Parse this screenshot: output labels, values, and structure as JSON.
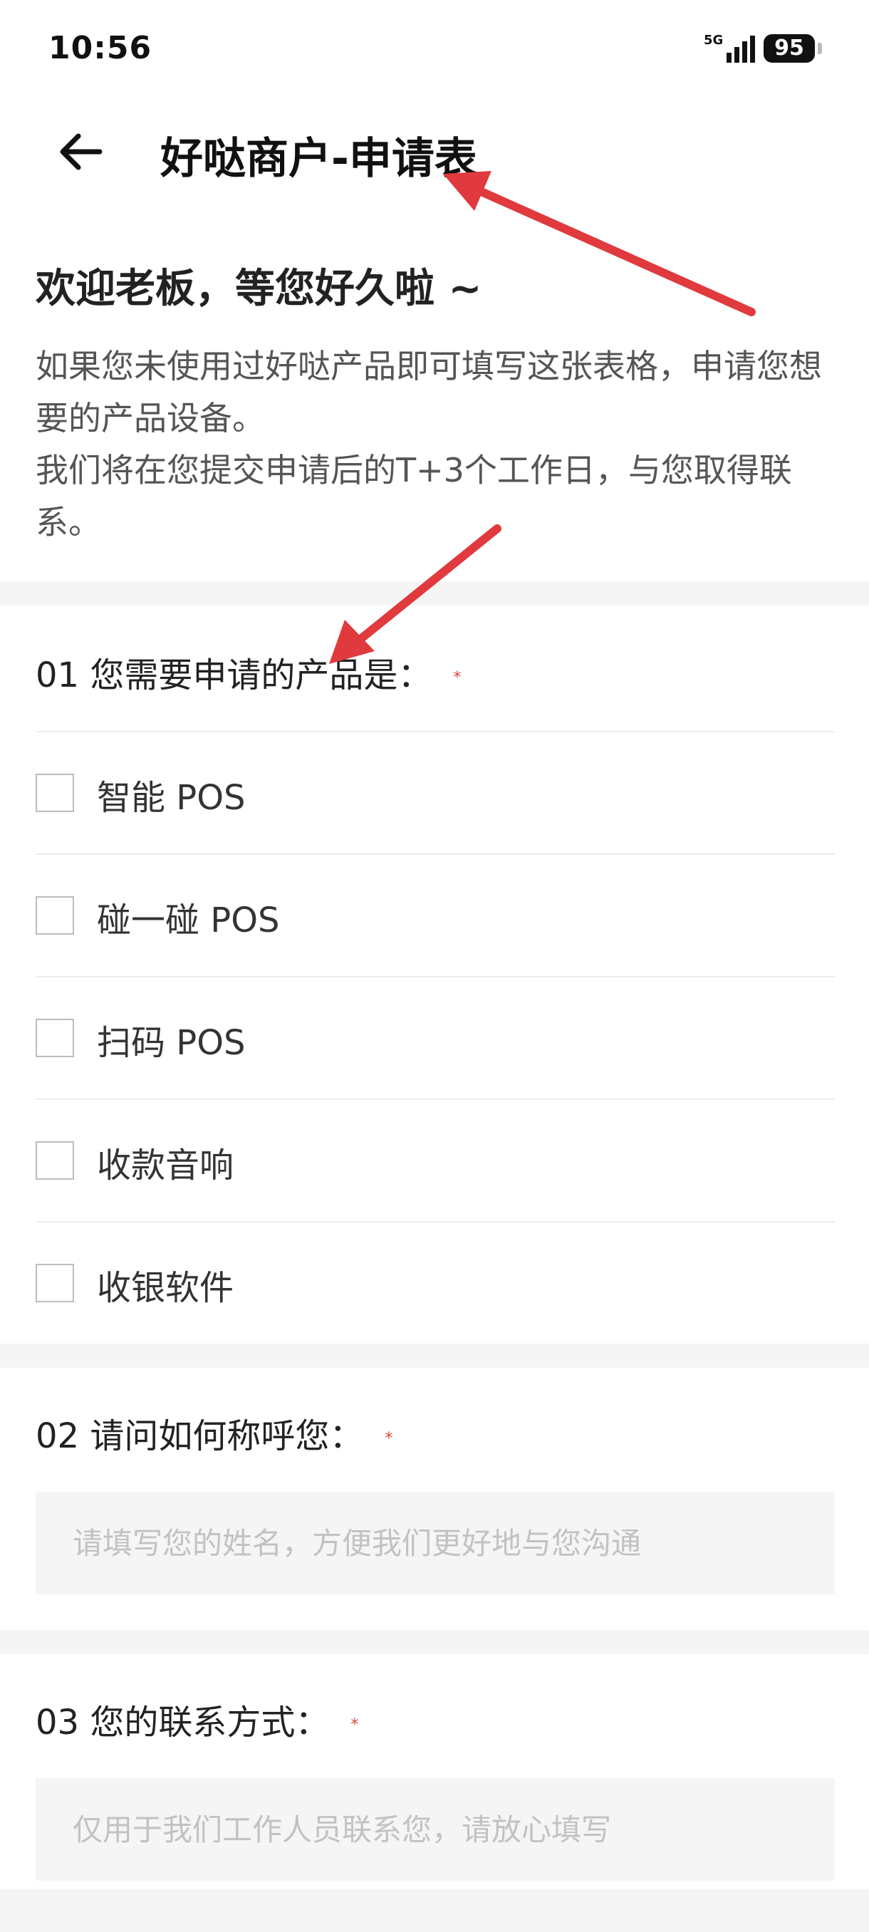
{
  "status_bar": {
    "time": "10:56",
    "network": "5G",
    "battery": "95"
  },
  "nav": {
    "title": "好哒商户-申请表",
    "back_icon": "arrow-left-icon"
  },
  "intro": {
    "title": "欢迎老板，等您好久啦 ~",
    "line1": "如果您未使用过好哒产品即可填写这张表格，申请您想要的产品设备。",
    "line2": "我们将在您提交申请后的T+3个工作日，与您取得联系。"
  },
  "questions": {
    "q1": {
      "label": "01 您需要申请的产品是：",
      "required_mark": "*",
      "options": [
        "智能 POS",
        "碰一碰 POS",
        "扫码 POS",
        "收款音响",
        "收银软件"
      ]
    },
    "q2": {
      "label": "02 请问如何称呼您：",
      "required_mark": "*",
      "placeholder": "请填写您的姓名，方便我们更好地与您沟通"
    },
    "q3": {
      "label": "03 您的联系方式：",
      "required_mark": "*",
      "placeholder": "仅用于我们工作人员联系您，请放心填写"
    }
  },
  "colors": {
    "required": "#e0443a",
    "annotation_arrow": "#e03a3e",
    "section_gap": "#f5f5f5",
    "input_bg": "#f5f5f5"
  }
}
